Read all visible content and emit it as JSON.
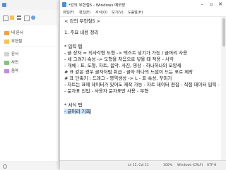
{
  "background_app": {
    "sidebar": {
      "items": [
        {
          "label": "내 문서"
        },
        {
          "label": "부헌철"
        },
        {
          "label": "문서"
        },
        {
          "label": "사진"
        },
        {
          "label": "음악"
        }
      ]
    }
  },
  "notepad": {
    "title": "*강의 부헌철5 - Windows 메모장",
    "menus": [
      "파일(F)",
      "편집(E)",
      "서식(O)",
      "보기(V)",
      "도움말(H)"
    ],
    "lines": [
      "< 강의 부헌철5 >",
      "",
      "1. 주요 내용 정리",
      "",
      "* 입력 탭",
      "- 글 상자 = 직사각형 도형 -> 텍스트 넣기가 가능 / 글머리 사용",
      "- 세 그려기 속성 -> 도형을 처음으로 넣을 때 적용 - 사각",
      "- 개체 : 표, 도형, 차트, 음악, 사진, 영상 - 하나하나의 모양새",
      "  # 표 같은 경우 글자처럼 취급 - 글자 하나의 느낌이 드는 표로 제작",
      "  # 표 단축키 : 드래그 - 명역생성 -> L - 표 속성, 꾸미기",
      "- 차트는 표에 데이터가 있어도 제작 가능 - 차트 데이터 편집 - 직접 데이터 입력 - 진행",
      "- 문자표 진입 - 사용자 문자표만 사용 - 무형",
      "",
      "* 서식 탭",
      "- 글머리 기호"
    ],
    "status": {
      "position": "Ln 15, Col 11",
      "zoom": "100%",
      "line_ending": "Windows (CRLF)",
      "encoding": "UTF-8"
    }
  }
}
